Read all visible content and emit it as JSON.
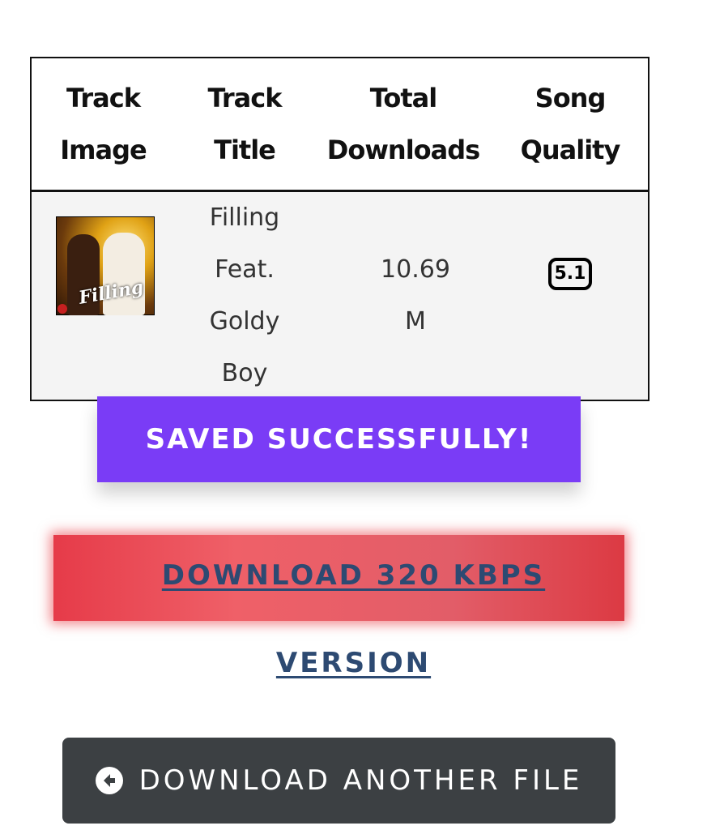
{
  "table": {
    "headers": [
      "Track Image",
      "Track Title",
      "Total Downloads",
      "Song Quality"
    ],
    "row": {
      "cover_title": "Filling",
      "title": "Filling Feat. Goldy Boy",
      "downloads": "10.69 M",
      "quality": "5.1"
    }
  },
  "actions": {
    "saved_label": "SAVED SUCCESSFULLY!",
    "download_line1": "DOWNLOAD 320 KBPS",
    "download_line2": "VERSION",
    "another_label": "DOWNLOAD ANOTHER FILE"
  },
  "colors": {
    "saved_bg": "#7a3cf6",
    "download_bg": "#e63b49",
    "link": "#2d4a72",
    "another_bg": "#3c4043"
  },
  "icons": {
    "back": "arrow-left-circle-icon",
    "quality": "surround-5-1-icon"
  }
}
